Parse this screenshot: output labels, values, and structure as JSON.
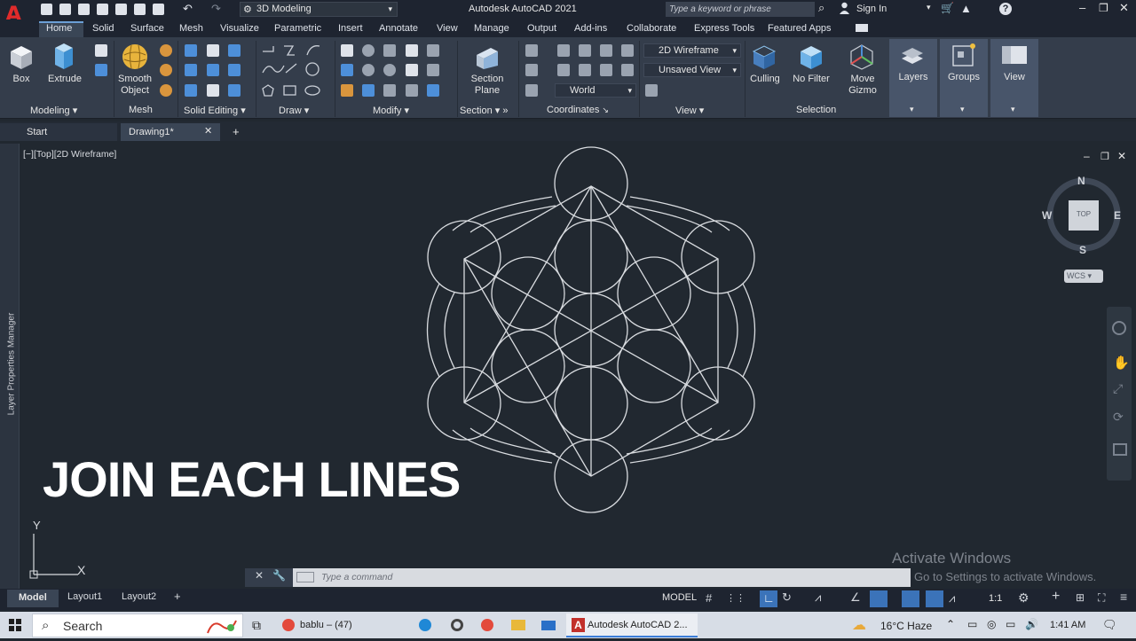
{
  "app": {
    "title": "Autodesk AutoCAD 2021",
    "workspace": "3D Modeling",
    "search_placeholder": "Type a keyword or phrase",
    "sign_in": "Sign In"
  },
  "ribbon": {
    "tabs": [
      "Home",
      "Solid",
      "Surface",
      "Mesh",
      "Visualize",
      "Parametric",
      "Insert",
      "Annotate",
      "View",
      "Manage",
      "Output",
      "Add-ins",
      "Collaborate",
      "Express Tools",
      "Featured Apps"
    ],
    "active_tab": "Home",
    "tools": {
      "box": "Box",
      "extrude": "Extrude",
      "smooth_object": [
        "Smooth",
        "Object"
      ],
      "section_plane": [
        "Section",
        "Plane"
      ],
      "culling": "Culling",
      "no_filter": "No Filter",
      "move_gizmo": [
        "Move",
        "Gizmo"
      ],
      "layers": "Layers",
      "groups": "Groups",
      "view": "View"
    },
    "dropdowns": {
      "visual_style": "2D Wireframe",
      "named_view": "Unsaved View",
      "ucs": "World"
    },
    "panels": [
      "Modeling",
      "Mesh",
      "Solid Editing",
      "Draw",
      "Modify",
      "Section",
      "Coordinates",
      "View",
      "Selection"
    ]
  },
  "doc_tabs": {
    "start": "Start",
    "drawing": "Drawing1*"
  },
  "viewport": {
    "label": "[−][Top][2D Wireframe]",
    "overlay_text": "JOIN EACH LINES",
    "viewcube": {
      "n": "N",
      "s": "S",
      "e": "E",
      "w": "W",
      "top": "TOP",
      "wcs": "WCS"
    },
    "ucs": {
      "x": "X",
      "y": "Y"
    }
  },
  "side_palette": "Layer Properties Manager",
  "command_line": {
    "placeholder": "Type a command"
  },
  "watermark": {
    "title": "Activate Windows",
    "subtitle": "Go to Settings to activate Windows."
  },
  "layout_tabs": [
    "Model",
    "Layout1",
    "Layout2"
  ],
  "status_bar": {
    "space": "MODEL",
    "scale": "1:1"
  },
  "taskbar": {
    "search": "Search",
    "chrome_window": "bablu – (47)",
    "acad_window": "Autodesk AutoCAD 2...",
    "weather": "16°C Haze",
    "time": "1:41 AM"
  },
  "colors": {
    "accent": "#e02b2b",
    "viewport_bg": "#212830",
    "ribbon_bg": "#343d4b",
    "wire": "#d9dce0"
  }
}
